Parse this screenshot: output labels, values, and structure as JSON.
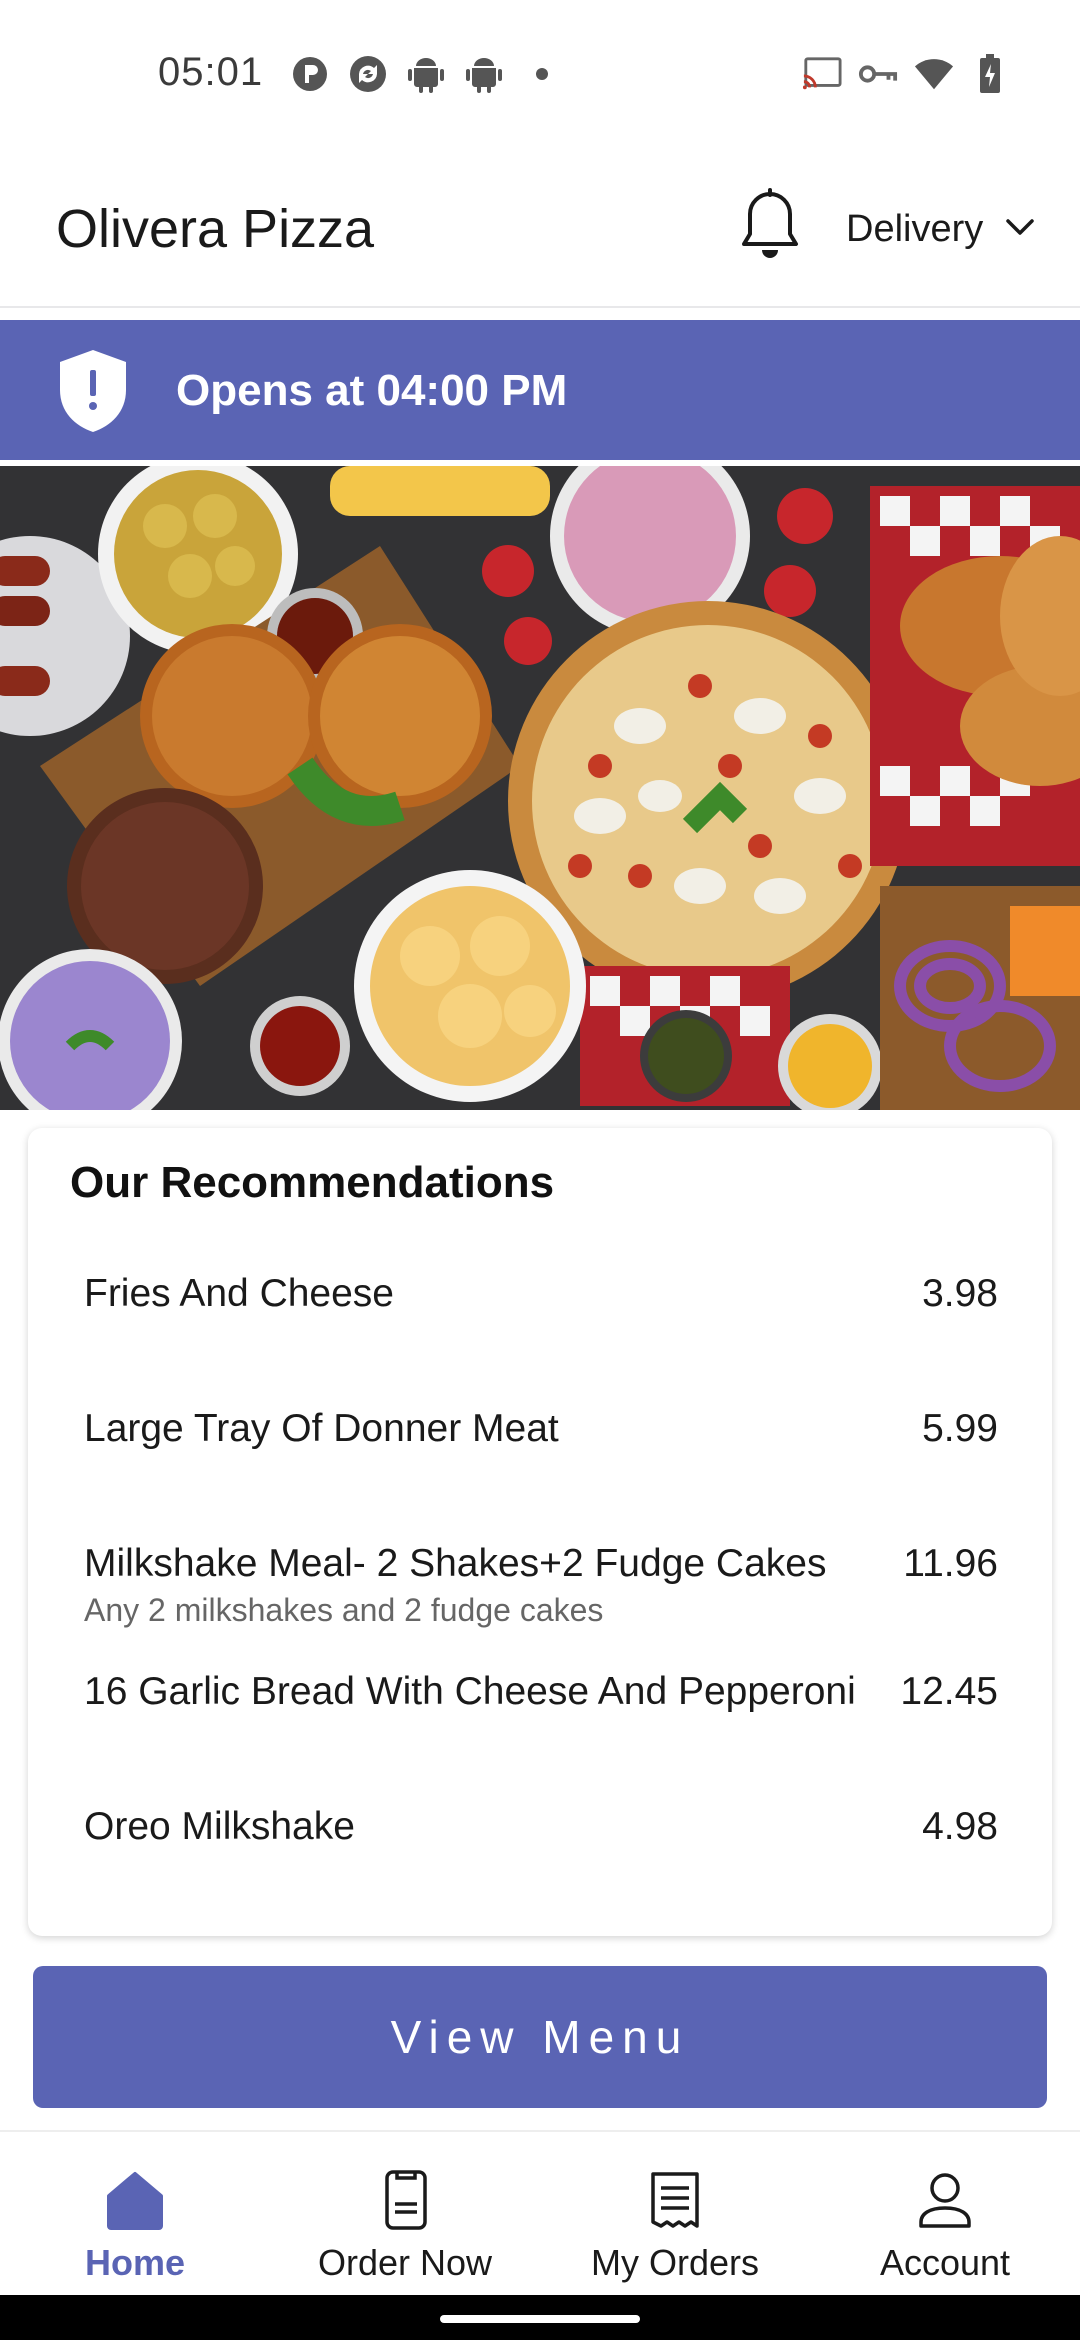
{
  "status_bar": {
    "time": "05:01"
  },
  "header": {
    "title": "Olivera Pizza",
    "delivery_mode": "Delivery"
  },
  "banner": {
    "text": "Opens at 04:00 PM"
  },
  "recommendations": {
    "title": "Our Recommendations",
    "items": [
      {
        "name": "Fries And Cheese",
        "price": "3.98",
        "description": ""
      },
      {
        "name": "Large Tray Of Donner Meat",
        "price": "5.99",
        "description": ""
      },
      {
        "name": "Milkshake Meal- 2 Shakes+2 Fudge Cakes",
        "price": "11.96",
        "description": "Any 2 milkshakes and 2 fudge cakes"
      },
      {
        "name": "16 Garlic Bread With Cheese And Pepperoni",
        "price": "12.45",
        "description": ""
      },
      {
        "name": "Oreo Milkshake",
        "price": "4.98",
        "description": ""
      }
    ]
  },
  "view_menu_label": "View Menu",
  "bottom_nav": {
    "items": [
      {
        "label": "Home",
        "icon": "home-icon",
        "active": true
      },
      {
        "label": "Order Now",
        "icon": "order-now-icon",
        "active": false
      },
      {
        "label": "My Orders",
        "icon": "receipt-icon",
        "active": false
      },
      {
        "label": "Account",
        "icon": "account-icon",
        "active": false
      }
    ]
  },
  "colors": {
    "accent": "#5a64b4",
    "text": "#1a1a1a"
  }
}
